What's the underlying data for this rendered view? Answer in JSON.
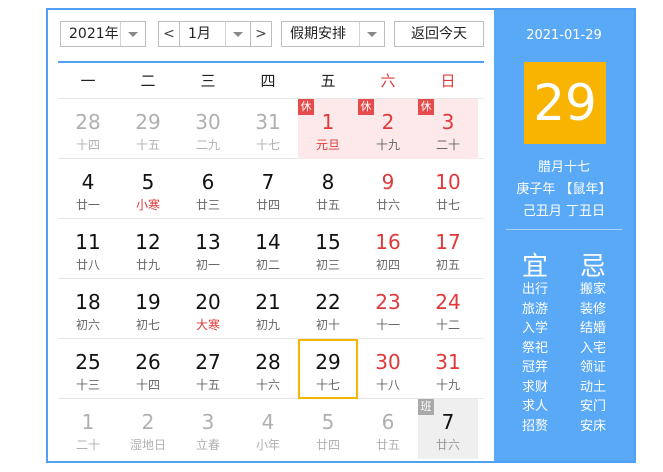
{
  "toolbar": {
    "year": "2021年",
    "month": "1月",
    "holiday_select": "假期安排",
    "prev": "<",
    "next": ">",
    "today": "返回今天"
  },
  "weekdays": [
    "一",
    "二",
    "三",
    "四",
    "五",
    "六",
    "日"
  ],
  "weeks": [
    [
      {
        "n": "28",
        "l": "十四",
        "t": "other"
      },
      {
        "n": "29",
        "l": "十五",
        "t": "other"
      },
      {
        "n": "30",
        "l": "二九",
        "t": "other"
      },
      {
        "n": "31",
        "l": "十七",
        "t": "other"
      },
      {
        "n": "1",
        "l": "元旦",
        "t": "holiday h1",
        "badge": "休"
      },
      {
        "n": "2",
        "l": "十九",
        "t": "holiday h2",
        "badge": "休"
      },
      {
        "n": "3",
        "l": "二十",
        "t": "holiday h3",
        "badge": "休"
      }
    ],
    [
      {
        "n": "4",
        "l": "廿一",
        "t": ""
      },
      {
        "n": "5",
        "l": "小寒",
        "t": "term"
      },
      {
        "n": "6",
        "l": "廿三",
        "t": ""
      },
      {
        "n": "7",
        "l": "廿四",
        "t": ""
      },
      {
        "n": "8",
        "l": "廿五",
        "t": ""
      },
      {
        "n": "9",
        "l": "廿六",
        "t": "weekend"
      },
      {
        "n": "10",
        "l": "廿七",
        "t": "weekend"
      }
    ],
    [
      {
        "n": "11",
        "l": "廿八",
        "t": ""
      },
      {
        "n": "12",
        "l": "廿九",
        "t": ""
      },
      {
        "n": "13",
        "l": "初一",
        "t": ""
      },
      {
        "n": "14",
        "l": "初二",
        "t": ""
      },
      {
        "n": "15",
        "l": "初三",
        "t": ""
      },
      {
        "n": "16",
        "l": "初四",
        "t": "weekend"
      },
      {
        "n": "17",
        "l": "初五",
        "t": "weekend"
      }
    ],
    [
      {
        "n": "18",
        "l": "初六",
        "t": ""
      },
      {
        "n": "19",
        "l": "初七",
        "t": ""
      },
      {
        "n": "20",
        "l": "大寒",
        "t": "term"
      },
      {
        "n": "21",
        "l": "初九",
        "t": ""
      },
      {
        "n": "22",
        "l": "初十",
        "t": ""
      },
      {
        "n": "23",
        "l": "十一",
        "t": "weekend"
      },
      {
        "n": "24",
        "l": "十二",
        "t": "weekend"
      }
    ],
    [
      {
        "n": "25",
        "l": "十三",
        "t": ""
      },
      {
        "n": "26",
        "l": "十四",
        "t": ""
      },
      {
        "n": "27",
        "l": "十五",
        "t": ""
      },
      {
        "n": "28",
        "l": "十六",
        "t": ""
      },
      {
        "n": "29",
        "l": "十七",
        "t": "selected"
      },
      {
        "n": "30",
        "l": "十八",
        "t": "weekend"
      },
      {
        "n": "31",
        "l": "十九",
        "t": "weekend"
      }
    ],
    [
      {
        "n": "1",
        "l": "二十",
        "t": "other"
      },
      {
        "n": "2",
        "l": "湿地日",
        "t": "other"
      },
      {
        "n": "3",
        "l": "立春",
        "t": "other"
      },
      {
        "n": "4",
        "l": "小年",
        "t": "other"
      },
      {
        "n": "5",
        "l": "廿四",
        "t": "other"
      },
      {
        "n": "6",
        "l": "廿五",
        "t": "other"
      },
      {
        "n": "7",
        "l": "廿六",
        "t": "work",
        "badge": "班"
      }
    ]
  ],
  "panel": {
    "date": "2021-01-29",
    "day": "29",
    "lunar": "腊月十七",
    "ganzhi_year": "庚子年 【鼠年】",
    "ganzhi_month_day": "己丑月 丁丑日",
    "yi_title": "宜",
    "ji_title": "忌",
    "yi": [
      "出行",
      "旅游",
      "入学",
      "祭祀",
      "冠笄",
      "求财",
      "求人",
      "招赘"
    ],
    "ji": [
      "搬家",
      "装修",
      "结婚",
      "入宅",
      "领证",
      "动土",
      "安门",
      "安床"
    ]
  },
  "colors": {
    "accent": "#4e9ff5",
    "panel_bg": "#5aa9f7",
    "today_bg": "#f8b400",
    "holiday_red": "#e0393a",
    "selected_border": "#f2b705"
  }
}
